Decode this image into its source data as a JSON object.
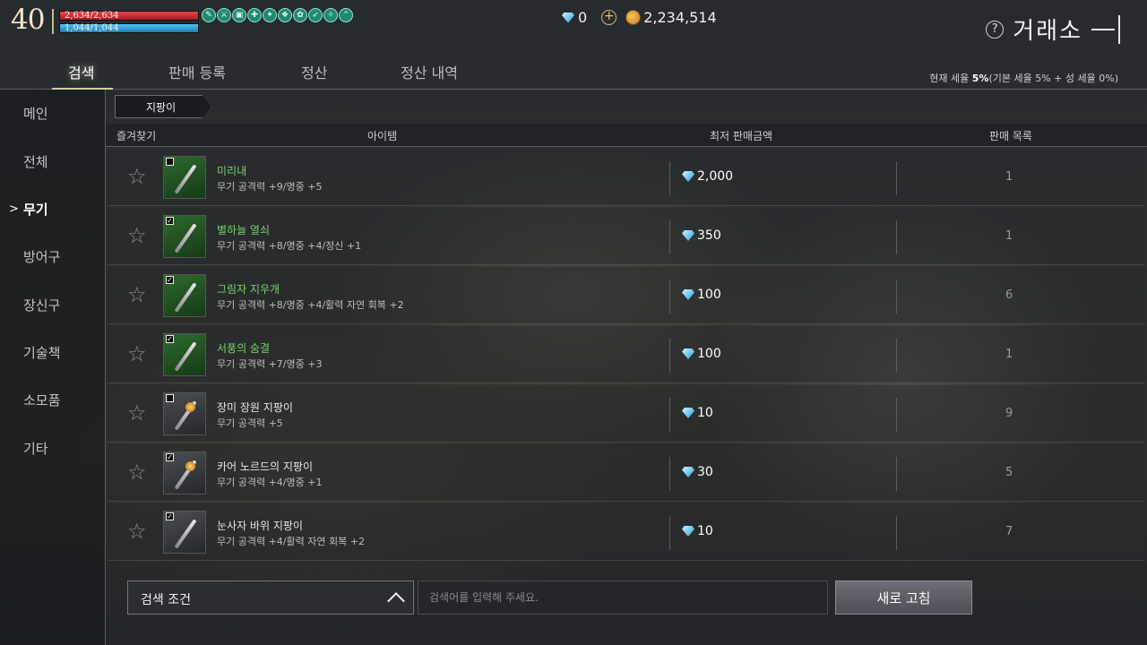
{
  "hud": {
    "level": "40",
    "hp": "2,634/2,634",
    "mp": "1,044/1,044",
    "buffs": [
      "✎",
      "⚔",
      "▣",
      "✚",
      "✦",
      "❖",
      "✿",
      "➶",
      "✧",
      "⌃"
    ]
  },
  "currency": {
    "diamonds": "0",
    "gold": "2,234,514"
  },
  "title": "거래소",
  "tabs": [
    {
      "label": "검색",
      "active": true
    },
    {
      "label": "판매 등록",
      "active": false
    },
    {
      "label": "정산",
      "active": false
    },
    {
      "label": "정산 내역",
      "active": false
    }
  ],
  "tax": {
    "prefix": "현재 세율 ",
    "rate": "5%",
    "detail": "(기본 세율 5% + 성 세율 0%)"
  },
  "sidebar": {
    "items": [
      {
        "label": "메인"
      },
      {
        "label": "전체"
      },
      {
        "label": "무기"
      },
      {
        "label": "방어구"
      },
      {
        "label": "장신구"
      },
      {
        "label": "기술책"
      },
      {
        "label": "소모품"
      },
      {
        "label": "기타"
      }
    ],
    "active_index": 2
  },
  "breadcrumb": "지팡이",
  "table": {
    "headers": {
      "favorite": "즐겨찾기",
      "item": "아이템",
      "lowest_price": "최저 판매금액",
      "listings": "판매 목록"
    },
    "rows": [
      {
        "name": "미리내",
        "stats": "무기 공격력 +9/명중 +5",
        "price": "2,000",
        "count": "1",
        "grade": "green",
        "checked": false,
        "icon": "staff"
      },
      {
        "name": "별하늘 열쇠",
        "stats": "무기 공격력 +8/명중 +4/정신 +1",
        "price": "350",
        "count": "1",
        "grade": "green",
        "checked": true,
        "icon": "staff"
      },
      {
        "name": "그림자 지우개",
        "stats": "무기 공격력 +8/명중 +4/활력 자연 회복 +2",
        "price": "100",
        "count": "6",
        "grade": "green",
        "checked": true,
        "icon": "staff"
      },
      {
        "name": "서풍의 숨결",
        "stats": "무기 공격력 +7/명중 +3",
        "price": "100",
        "count": "1",
        "grade": "green",
        "checked": true,
        "icon": "staff"
      },
      {
        "name": "장미 장원 지팡이",
        "stats": "무기 공격력 +5",
        "price": "10",
        "count": "9",
        "grade": "white",
        "checked": false,
        "icon": "gem-staff"
      },
      {
        "name": "카어 노르드의 지팡이",
        "stats": "무기 공격력 +4/명중 +1",
        "price": "30",
        "count": "5",
        "grade": "white",
        "checked": true,
        "icon": "gem-staff"
      },
      {
        "name": "눈사자 바위 지팡이",
        "stats": "무기 공격력 +4/활력 자연 회복 +2",
        "price": "10",
        "count": "7",
        "grade": "white",
        "checked": true,
        "icon": "staff"
      }
    ]
  },
  "search": {
    "condition_label": "검색 조건",
    "placeholder": "검색어를 입력해 주세요.",
    "refresh_label": "새로 고침"
  }
}
